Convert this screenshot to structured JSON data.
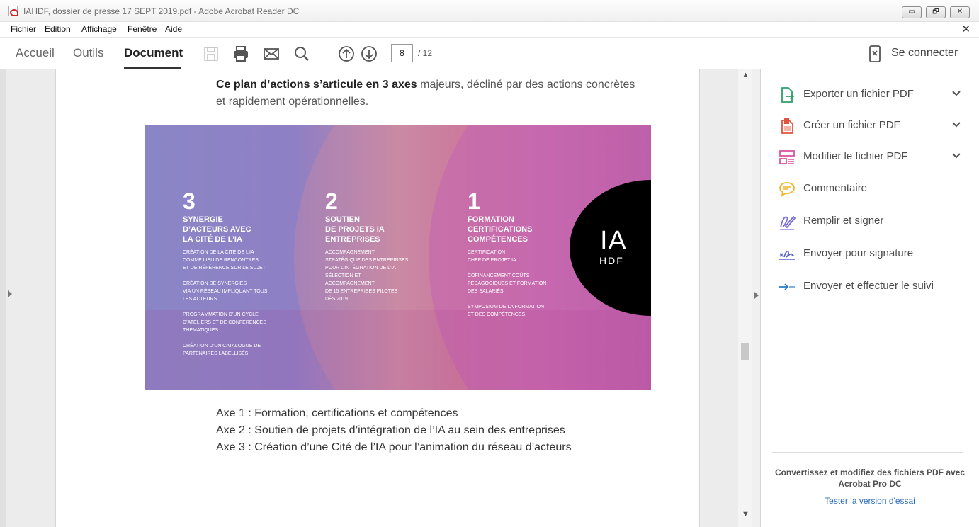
{
  "window": {
    "title": "IAHDF, dossier de presse 17 SEPT 2019.pdf - Adobe Acrobat Reader DC",
    "buttons": [
      "▭",
      "🗗",
      "✕"
    ]
  },
  "menu": [
    "Fichier",
    "Edition",
    "Affichage",
    "Fenêtre",
    "Aide"
  ],
  "toolbar": {
    "tabs": [
      "Accueil",
      "Outils",
      "Document"
    ],
    "active_tab": "Document",
    "page_current": "8",
    "page_total": "/ 12",
    "connect_label": "Se connecter"
  },
  "document": {
    "intro_bold": "Ce plan d’actions s’articule en 3 axes",
    "intro_rest": " majeurs, décliné par des actions concrètes et rapidement opérationnelles.",
    "banner": {
      "columns": [
        {
          "num": "3",
          "heading": "SYNERGIE\nD’ACTEURS AVEC\nLA CITÉ DE L’IA",
          "body": "CRÉATION DE LA CITÉ DE L’IA\nCOMME LIEU DE RENCONTRES\nET DE RÉFÉRENCE SUR LE SUJET\n\nCRÉATION DE SYNERGIES\nVIA UN RÉSEAU IMPLIQUANT TOUS\nLES ACTEURS\n\nPROGRAMMATION D’UN CYCLE\nD’ATELIERS ET DE CONFÉRENCES\nTHÉMATIQUES\n\nCRÉATION D’UN CATALOGUE DE\nPARTENAIRES LABELLISÉS"
        },
        {
          "num": "2",
          "heading": "SOUTIEN\nDE PROJETS IA\nENTREPRISES",
          "body": "ACCOMPAGNEMENT\nSTRATÉGIQUE DES ENTREPRISES\nPOUR L’INTÉGRATION DE L’IA\nSÉLECTION ET\nACCOMPAGNEMENT\nDE 15 ENTREPRISES PILOTES\nDÈS 2019"
        },
        {
          "num": "1",
          "heading": "FORMATION\nCERTIFICATIONS\nCOMPÉTENCES",
          "body": "CERTIFICATION\nCHEF DE PROJET IA\n\nCOFINANCEMENT COÛTS\nPÉDAGOGIQUES ET FORMATION\nDES SALARIÉS\n\nSYMPOSIUM DE LA FORMATION\nET DES COMPÉTENCES"
        }
      ],
      "logo_top": "IA",
      "logo_bottom": "HDF"
    },
    "axes": [
      "Axe 1 : Formation, certifications et compétences",
      "Axe 2 : Soutien de projets d’intégration de l’IA au sein des entreprises",
      "Axe 3 : Création d’une Cité de l’IA pour l’animation du réseau d’acteurs"
    ]
  },
  "tools_panel": {
    "tools": [
      {
        "label": "Exporter un fichier PDF",
        "icon": "export-pdf-icon",
        "color": "#2e9e6b"
      },
      {
        "label": "Créer un fichier PDF",
        "icon": "create-pdf-icon",
        "color": "#e0533f"
      },
      {
        "label": "Modifier le fichier PDF",
        "icon": "edit-pdf-icon",
        "color": "#d9569f"
      },
      {
        "label": "Commentaire",
        "icon": "comment-icon",
        "color": "#f0b429"
      },
      {
        "label": "Remplir et signer",
        "icon": "fill-sign-icon",
        "color": "#7a6fd6"
      },
      {
        "label": "Envoyer pour signature",
        "icon": "send-signature-icon",
        "color": "#5b62c9"
      },
      {
        "label": "Envoyer et effectuer le suivi",
        "icon": "send-track-icon",
        "color": "#2a7bd0"
      }
    ],
    "promo": "Convertissez et modifiez des fichiers PDF avec Acrobat Pro DC",
    "trial_link": "Tester la version d'essai"
  }
}
